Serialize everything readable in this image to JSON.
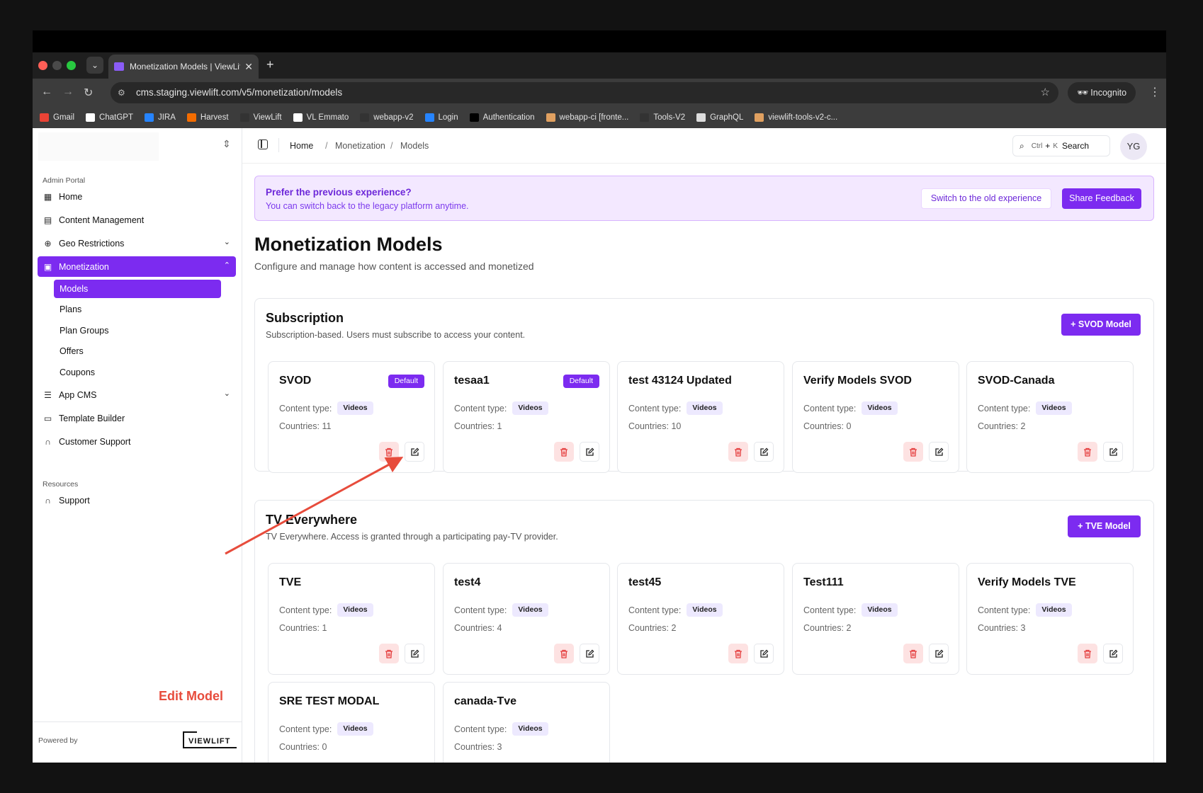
{
  "browser": {
    "tab_title": "Monetization Models | ViewLift",
    "url": "cms.staging.viewlift.com/v5/monetization/models",
    "incognito_label": "Incognito",
    "bookmarks": [
      {
        "label": "Gmail",
        "color": "#ea4335"
      },
      {
        "label": "ChatGPT",
        "color": "#ffffff"
      },
      {
        "label": "JIRA",
        "color": "#2684ff"
      },
      {
        "label": "Harvest",
        "color": "#f36c00"
      },
      {
        "label": "ViewLift",
        "color": "#333333"
      },
      {
        "label": "VL Emmato",
        "color": "#ffffff"
      },
      {
        "label": "webapp-v2",
        "color": "#333333"
      },
      {
        "label": "Login",
        "color": "#2684ff"
      },
      {
        "label": "Authentication",
        "color": "#000000"
      },
      {
        "label": "webapp-ci [fronte...",
        "color": "#e0a060"
      },
      {
        "label": "Tools-V2",
        "color": "#333333"
      },
      {
        "label": "GraphQL",
        "color": "#dddddd"
      },
      {
        "label": "viewlift-tools-v2-c...",
        "color": "#e0a060"
      }
    ]
  },
  "sidebar": {
    "section_admin": "Admin Portal",
    "items": [
      {
        "label": "Home",
        "icon": "grid-icon"
      },
      {
        "label": "Content Management",
        "icon": "film-icon"
      },
      {
        "label": "Geo Restrictions",
        "icon": "globe-icon"
      },
      {
        "label": "Monetization",
        "icon": "wallet-icon"
      },
      {
        "label": "App CMS",
        "icon": "sliders-icon"
      },
      {
        "label": "Template Builder",
        "icon": "layout-icon"
      },
      {
        "label": "Customer Support",
        "icon": "headset-icon"
      }
    ],
    "subitems": [
      "Models",
      "Plans",
      "Plan Groups",
      "Offers",
      "Coupons"
    ],
    "section_resources": "Resources",
    "support_label": "Support",
    "powered_by": "Powered by",
    "logo_text": "VIEWLIFT"
  },
  "header": {
    "breadcrumb": [
      "Home",
      "Monetization",
      "Models"
    ],
    "search_ctrl": "Ctrl",
    "search_plus": "+",
    "search_k": "K",
    "search_label": "Search",
    "avatar_initials": "YG"
  },
  "banner": {
    "title": "Prefer the previous experience?",
    "subtitle": "You can switch back to the legacy platform anytime.",
    "switch_label": "Switch to the old experience",
    "feedback_label": "Share Feedback"
  },
  "page": {
    "title": "Monetization Models",
    "subtitle": "Configure and manage how content is accessed and monetized"
  },
  "labels": {
    "content_type": "Content type:",
    "countries_prefix": "Countries: ",
    "default_badge": "Default"
  },
  "sections": [
    {
      "title": "Subscription",
      "description": "Subscription-based. Users must subscribe to access your content.",
      "add_label": "SVOD Model",
      "models": [
        {
          "name": "SVOD",
          "content_type": "Videos",
          "countries": "11",
          "default": true
        },
        {
          "name": "tesaa1",
          "content_type": "Videos",
          "countries": "1",
          "default": true
        },
        {
          "name": "test 43124 Updated",
          "content_type": "Videos",
          "countries": "10",
          "default": false
        },
        {
          "name": "Verify Models SVOD",
          "content_type": "Videos",
          "countries": "0",
          "default": false
        },
        {
          "name": "SVOD-Canada",
          "content_type": "Videos",
          "countries": "2",
          "default": false
        }
      ]
    },
    {
      "title": "TV Everywhere",
      "description": "TV Everywhere. Access is granted through a participating pay-TV provider.",
      "add_label": "TVE Model",
      "models": [
        {
          "name": "TVE",
          "content_type": "Videos",
          "countries": "1",
          "default": false
        },
        {
          "name": "test4",
          "content_type": "Videos",
          "countries": "4",
          "default": false
        },
        {
          "name": "test45",
          "content_type": "Videos",
          "countries": "2",
          "default": false
        },
        {
          "name": "Test111",
          "content_type": "Videos",
          "countries": "2",
          "default": false
        },
        {
          "name": "Verify Models TVE",
          "content_type": "Videos",
          "countries": "3",
          "default": false
        },
        {
          "name": "SRE TEST MODAL",
          "content_type": "Videos",
          "countries": "0",
          "default": false
        },
        {
          "name": "canada-Tve",
          "content_type": "Videos",
          "countries": "3",
          "default": false
        }
      ]
    }
  ],
  "annotation": {
    "text": "Edit Model",
    "color": "#e74c3c"
  },
  "colors": {
    "accent": "#7c2bf0",
    "delete_bg": "#fde2e2",
    "delete_icon": "#e53e3e"
  }
}
